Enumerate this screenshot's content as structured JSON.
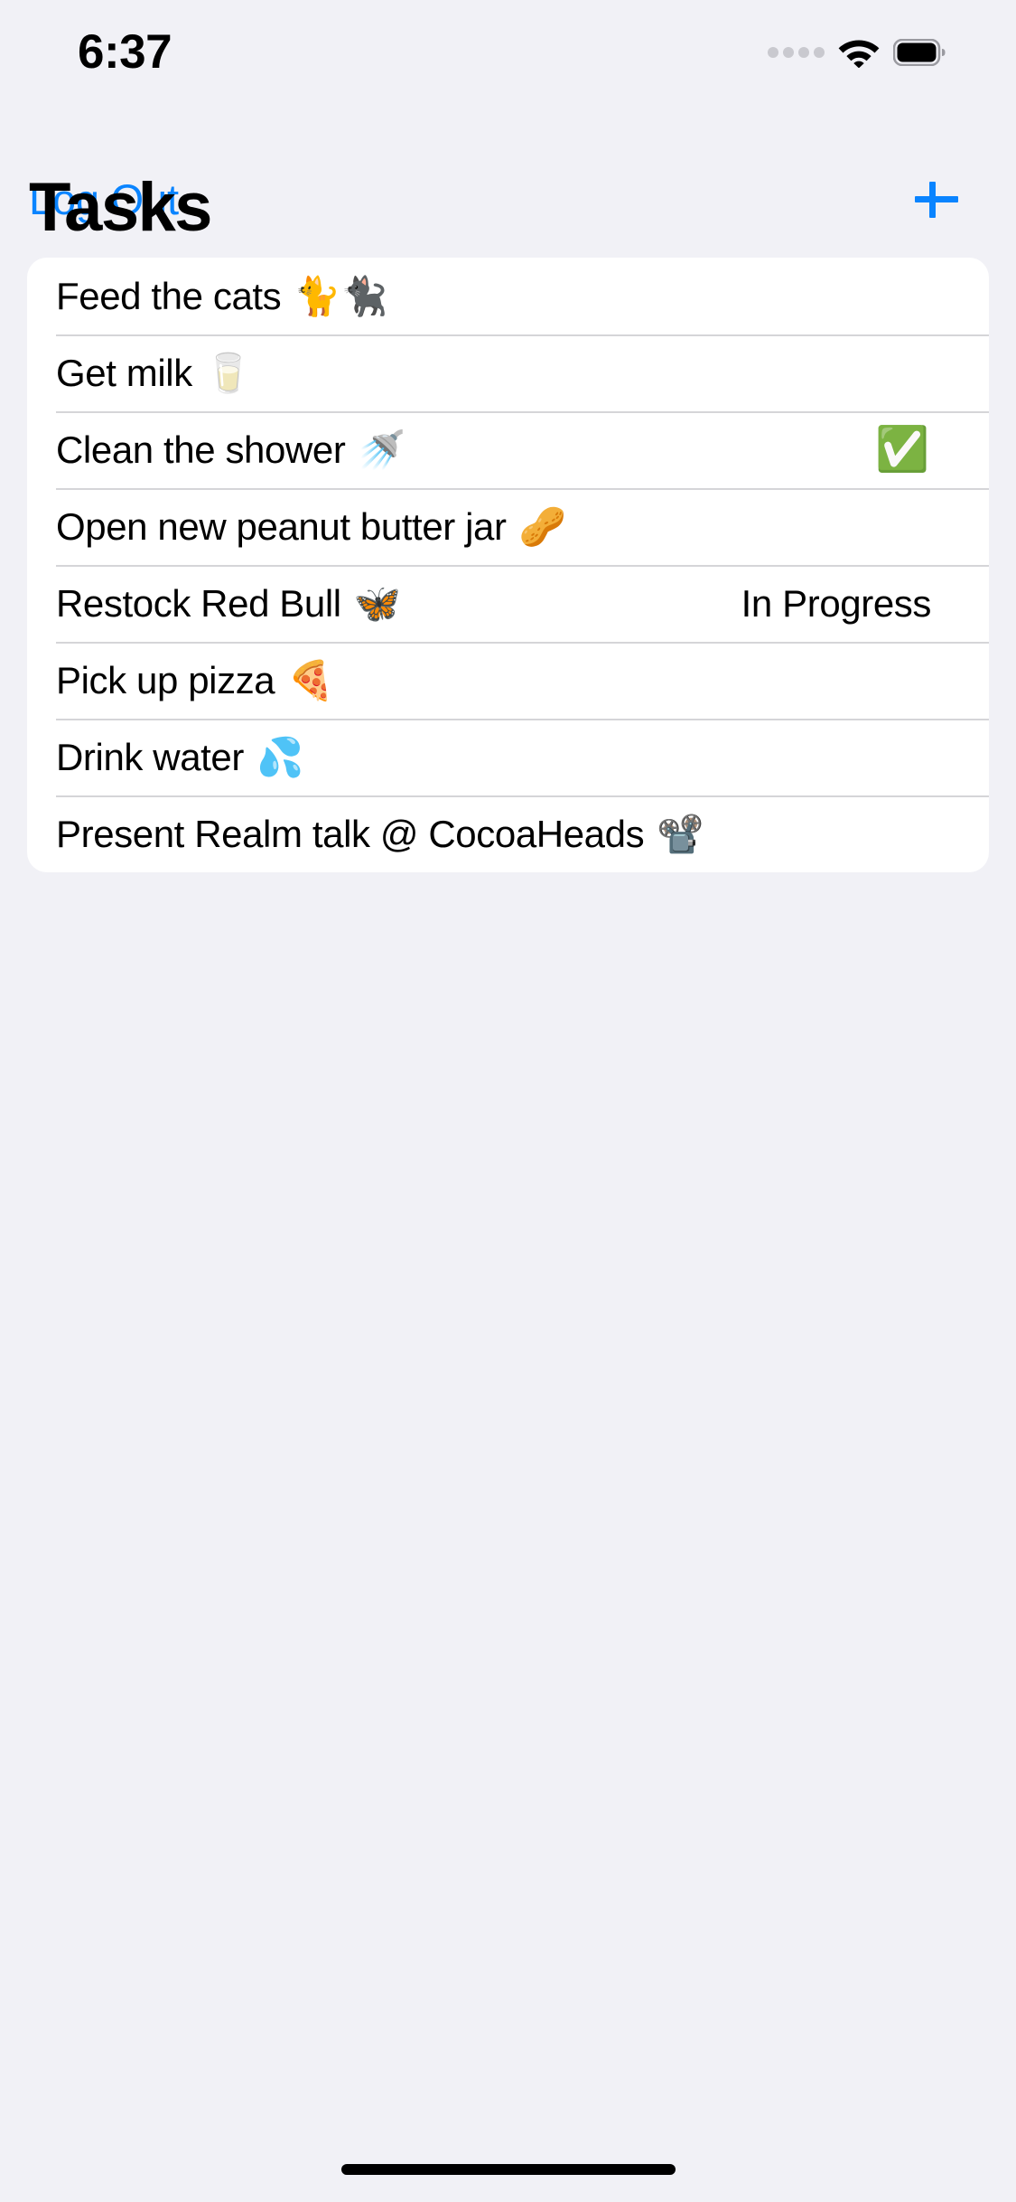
{
  "status_bar": {
    "time": "6:37",
    "signal_icon": "signal-dots-icon",
    "wifi_icon": "wifi-icon",
    "battery_icon": "battery-full-icon",
    "dot_color": "#C9C9CF"
  },
  "nav_bar": {
    "left_button_label": "Log Out",
    "add_button_icon": "plus-icon",
    "accent_color": "#0A84FF"
  },
  "header": {
    "title": "Tasks"
  },
  "theme": {
    "background": "#F1F1F6",
    "card_background": "#FFFFFF",
    "separator": "#D5D5D8",
    "text": "#000000",
    "accent": "#0A84FF"
  },
  "task_list": {
    "rows": [
      {
        "title": "Feed the cats",
        "emoji": "🐈🐈‍⬛",
        "accessory": "none",
        "accessory_text": ""
      },
      {
        "title": "Get milk",
        "emoji": "🥛",
        "accessory": "none",
        "accessory_text": ""
      },
      {
        "title": "Clean the shower",
        "emoji": "🚿",
        "accessory": "check",
        "accessory_text": "✅"
      },
      {
        "title": "Open new peanut butter jar",
        "emoji": "🥜",
        "accessory": "none",
        "accessory_text": ""
      },
      {
        "title": "Restock Red Bull",
        "emoji": "🦋",
        "accessory": "text",
        "accessory_text": "In Progress"
      },
      {
        "title": "Pick up pizza",
        "emoji": "🍕",
        "accessory": "none",
        "accessory_text": ""
      },
      {
        "title": "Drink water",
        "emoji": "💦",
        "accessory": "none",
        "accessory_text": ""
      },
      {
        "title": "Present Realm talk @ CocoaHeads",
        "emoji": "📽️",
        "accessory": "none",
        "accessory_text": ""
      }
    ]
  },
  "home_indicator": {
    "label": "home-indicator"
  }
}
